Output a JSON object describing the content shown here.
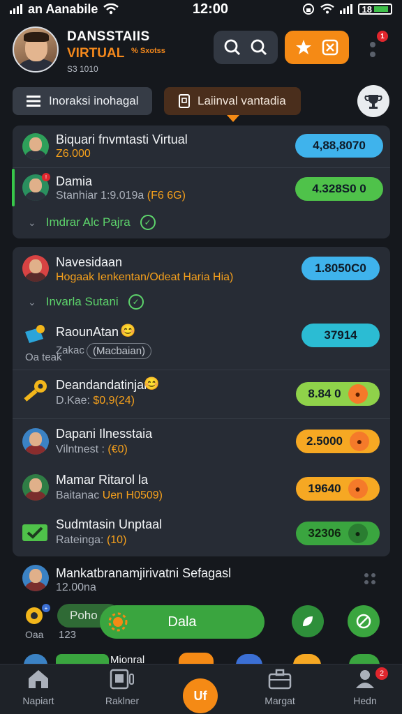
{
  "status_bar": {
    "carrier": "an Aanabile",
    "time": "12:00",
    "battery": "18"
  },
  "header": {
    "title": "DANSSTAIIS",
    "subtitle": "VIRTUAL",
    "subtitle_small": "% Sxotss",
    "code": "S3 1010",
    "notification_count": "1"
  },
  "tabs": {
    "first": "Inoraksi inohagal",
    "second": "Laiinval vantadia"
  },
  "card1": {
    "row1": {
      "title": "Biquari fnvmtasti Virtual",
      "sub": "Z6.000",
      "amount": "4,88,8070"
    },
    "row2": {
      "title": "Damia",
      "sub_gray": "Stanhiar 1:9.019a",
      "sub_orange": "(F6 6G)",
      "amount": "4.328S0 0"
    },
    "expander": "Imdrar Alc Pajra"
  },
  "card2": {
    "row1": {
      "title": "Navesidaan",
      "sub": "Hogaak Ienkentan/Odeat Haria Hia)",
      "amount": "1.8050C0"
    },
    "expander": "Invarla Sutani",
    "row2": {
      "title": "RaounAtan",
      "left_text": "Oa teak",
      "sub": "Zakac",
      "tag": "(Macbaian)",
      "amount": "37914"
    },
    "row3": {
      "title": "Deandandatinjan",
      "sub_gray": "D.Kae:",
      "sub_orange": "$0,9(24)",
      "amount": "8.84 0"
    },
    "row4": {
      "title": "Dapani Ilnesstaia",
      "sub_gray": "Vilntnest :",
      "sub_orange": "(€0)",
      "amount": "2.5000"
    },
    "row5": {
      "title": "Mamar Ritarol la",
      "sub_gray": "Baitanac",
      "sub_orange": "Uen H0509)",
      "amount": "19640"
    },
    "row6": {
      "title": "Sudmtasin Unptaal",
      "sub_gray": "Rateinga:",
      "sub_orange": "(10)",
      "amount": "32306"
    }
  },
  "bottom": {
    "row_title": "Mankatbranamjirivatni Sefagasl",
    "row_sub": "12.00na",
    "small_label": "Oaa",
    "small_pill": "Poho",
    "count": "123",
    "big_button": "Dala",
    "peek_label": "Mionral"
  },
  "nav": {
    "home": "Napiart",
    "second": "Raklner",
    "center": "Uf",
    "fourth": "Margat",
    "fifth": "Hedn",
    "fifth_badge": "2"
  },
  "colors": {
    "accent": "#f58a15",
    "green": "#3aa53f",
    "blue_pill": "#3fb3ec",
    "cyan_pill": "#2bbcd3",
    "lime_pill": "#8fd24a",
    "orange_pill": "#f6a823"
  }
}
